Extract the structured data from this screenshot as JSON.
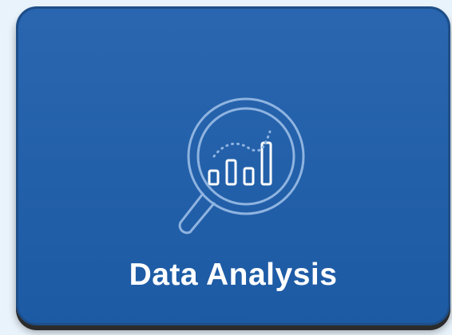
{
  "tile": {
    "label": "Data Analysis",
    "icon": "magnifier-bar-chart-icon",
    "background_color": "#1e5eab",
    "icon_color": "#8fb4e0"
  }
}
